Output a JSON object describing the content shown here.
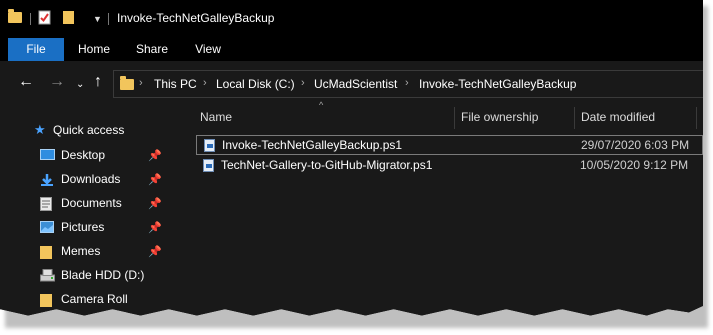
{
  "window": {
    "title": "Invoke-TechNetGalleyBackup"
  },
  "ribbon": {
    "tabs": [
      "File",
      "Home",
      "Share",
      "View"
    ]
  },
  "address": {
    "crumbs": [
      "This PC",
      "Local Disk (C:)",
      "UcMadScientist",
      "Invoke-TechNetGalleyBackup"
    ]
  },
  "nav": {
    "quick_access": "Quick access",
    "items": [
      {
        "label": "Desktop",
        "icon": "desktop-icon",
        "pinned": true
      },
      {
        "label": "Downloads",
        "icon": "downloads-icon",
        "pinned": true
      },
      {
        "label": "Documents",
        "icon": "documents-icon",
        "pinned": true
      },
      {
        "label": "Pictures",
        "icon": "pictures-icon",
        "pinned": true
      },
      {
        "label": "Memes",
        "icon": "folder-icon",
        "pinned": true
      },
      {
        "label": "Blade HDD (D:)",
        "icon": "drive-icon",
        "pinned": false
      },
      {
        "label": "Camera Roll",
        "icon": "folder-icon",
        "pinned": false
      }
    ]
  },
  "columns": {
    "name": "Name",
    "owner": "File ownership",
    "date": "Date modified"
  },
  "files": [
    {
      "name": "Invoke-TechNetGalleyBackup.ps1",
      "date": "29/07/2020 6:03 PM",
      "selected": true
    },
    {
      "name": "TechNet-Gallery-to-GitHub-Migrator.ps1",
      "date": "10/05/2020 9:12 PM",
      "selected": false
    }
  ],
  "colors": {
    "accent": "#1a6fc4",
    "folder": "#f2c55c",
    "background": "#191919",
    "titlebar": "#000000"
  }
}
